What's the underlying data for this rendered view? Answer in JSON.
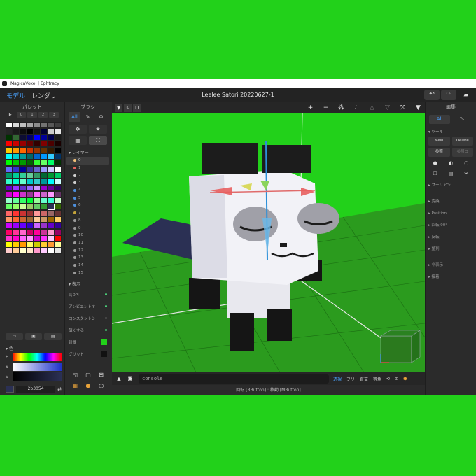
{
  "window": {
    "title": "MagicaVoxel | Ephtracy"
  },
  "header": {
    "tabs": [
      "モデル",
      "レンダリ"
    ],
    "project_title": "Leelee Satori 20220627-1"
  },
  "palette": {
    "title": "パレット",
    "tabs": [
      "▶",
      "0",
      "1",
      "2",
      "3"
    ],
    "colors": [
      "#ffffff",
      "#d9d9d9",
      "#bfbfbf",
      "#a6a6a6",
      "#8c8c8c",
      "#737373",
      "#595959",
      "#404040",
      "#262626",
      "#1a1a1a",
      "#0d0d0d",
      "#000000",
      "#141414",
      "#000033",
      "#cccccc",
      "#e6e6e6",
      "#003300",
      "#336633",
      "#0d0d33",
      "#000066",
      "#0000ff",
      "#000099",
      "#00004d",
      "#1a1a1a",
      "#ff0000",
      "#cc0000",
      "#990000",
      "#660000",
      "#330000",
      "#800000",
      "#4d0000",
      "#1a0000",
      "#ffcc00",
      "#ff9900",
      "#ff6600",
      "#cc3300",
      "#993300",
      "#663300",
      "#331a00",
      "#000000",
      "#00ffff",
      "#00cccc",
      "#009999",
      "#006666",
      "#0066cc",
      "#0099ff",
      "#33ccff",
      "#003366",
      "#00ff00",
      "#00cc00",
      "#009900",
      "#006600",
      "#33ff33",
      "#66ff66",
      "#00ff66",
      "#003300",
      "#6666ff",
      "#3333cc",
      "#000099",
      "#333399",
      "#6666cc",
      "#9999ff",
      "#ccccff",
      "#ffffff",
      "#009966",
      "#00cc99",
      "#33cc99",
      "#66cc99",
      "#339966",
      "#006633",
      "#009933",
      "#00cc66",
      "#33ffcc",
      "#00ffcc",
      "#66ffcc",
      "#00cccc",
      "#33cccc",
      "#009999",
      "#00ffff",
      "#ccffff",
      "#6600cc",
      "#9933ff",
      "#6633cc",
      "#9966ff",
      "#cc99ff",
      "#9900cc",
      "#660099",
      "#330066",
      "#cc00cc",
      "#ff00ff",
      "#cc33cc",
      "#993399",
      "#ff66ff",
      "#cc66cc",
      "#ff99ff",
      "#663366",
      "#99ffcc",
      "#66ff99",
      "#33ff66",
      "#00ff33",
      "#99ff99",
      "#66ffcc",
      "#33ffcc",
      "#ccffcc",
      "#66ff66",
      "#99ff66",
      "#ccff99",
      "#99cc66",
      "#66cc66",
      "#339933",
      "#2b3054",
      "#336600",
      "#ff6666",
      "#ff3333",
      "#cc3333",
      "#993333",
      "#ff9999",
      "#cc6666",
      "#996666",
      "#663333",
      "#ff9966",
      "#ff6633",
      "#cc6633",
      "#996633",
      "#ffcc99",
      "#cc9966",
      "#996600",
      "#ffcc66",
      "#cc00ff",
      "#9900ff",
      "#6600ff",
      "#3300cc",
      "#cc66ff",
      "#9933cc",
      "#6600cc",
      "#330099",
      "#ff0066",
      "#ff3399",
      "#ff66cc",
      "#cc0066",
      "#ff0099",
      "#cc3399",
      "#ff99cc",
      "#990066",
      "#ff33cc",
      "#ff00cc",
      "#ff66ff",
      "#ff99ff",
      "#cc00cc",
      "#ff33ff",
      "#ffccff",
      "#ff0000",
      "#ffff00",
      "#ffcc00",
      "#ff9900",
      "#ffff66",
      "#cccc00",
      "#ffcc33",
      "#ff9933",
      "#ffff99",
      "#ffcccc",
      "#ffcc99",
      "#ffffcc",
      "#ffe6cc",
      "#ff99cc",
      "#ffccff",
      "#ffffff",
      "#e6e6e6"
    ],
    "selected_index": 110,
    "color_section": "色",
    "hsv_labels": [
      "H",
      "S",
      "V"
    ],
    "hex_value": "2b3054",
    "current_color": "#2b3054"
  },
  "brush": {
    "title": "ブラシ",
    "tab_all": "All",
    "layers_head": "レイヤー",
    "layers": [
      {
        "label": "0",
        "color": "#f2c27a"
      },
      {
        "label": "1",
        "color": "#e8655f"
      },
      {
        "label": "2",
        "color": "#cfcfcf"
      },
      {
        "label": "3",
        "color": "#cfcfcf"
      },
      {
        "label": "4",
        "color": "#4d8fdb"
      },
      {
        "label": "5",
        "color": "#4d8fdb"
      },
      {
        "label": "6",
        "color": "#4d8fdb"
      },
      {
        "label": "7",
        "color": "#c4a43a"
      },
      {
        "label": "8",
        "color": "#9a9a9a"
      },
      {
        "label": "9",
        "color": "#9a9a9a"
      },
      {
        "label": "10",
        "color": "#9a9a9a"
      },
      {
        "label": "11",
        "color": "#9a9a9a"
      },
      {
        "label": "12",
        "color": "#9a9a9a"
      },
      {
        "label": "13",
        "color": "#9a9a9a"
      },
      {
        "label": "14",
        "color": "#9a9a9a"
      },
      {
        "label": "15",
        "color": "#9a9a9a"
      }
    ],
    "view_head": "表示",
    "view_items": [
      "高DPI",
      "アンビエントオ",
      "コンスタントシ",
      "薄くする",
      "背景",
      "グリッド"
    ]
  },
  "edit": {
    "title": "編集",
    "tab_all": "All",
    "tools_head": "ツール",
    "new_label": "New",
    "delete_label": "Delete",
    "ref_label": "参照",
    "ref2_label": "参照コ",
    "items": [
      "ブーリアン",
      "変換",
      "Position",
      "回転 90°",
      "反転",
      "整列",
      "非表示",
      "接着"
    ]
  },
  "console": {
    "text": "console"
  },
  "projection": {
    "modes": [
      "透視",
      "フリ",
      "直交",
      "等角"
    ],
    "active": "透視"
  },
  "status": {
    "text": "回転 [RButton] : 移動 [MButton]"
  }
}
